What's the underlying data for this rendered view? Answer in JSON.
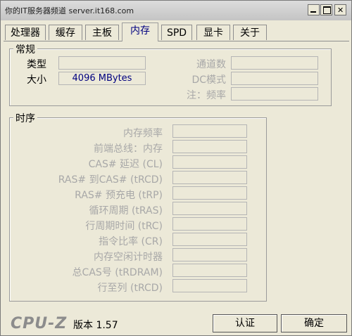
{
  "window": {
    "title": "你的IT服务器频道 server.it168.com"
  },
  "tabs": [
    {
      "label": "处理器"
    },
    {
      "label": "缓存"
    },
    {
      "label": "主板"
    },
    {
      "label": "内存"
    },
    {
      "label": "SPD"
    },
    {
      "label": "显卡"
    },
    {
      "label": "关于"
    }
  ],
  "general": {
    "title": "常规",
    "type_label": "类型",
    "type_value": "",
    "size_label": "大小",
    "size_value": "4096 MBytes",
    "channels_label": "通道数",
    "channels_value": "",
    "dc_mode_label": "DC模式",
    "dc_mode_value": "",
    "note_label": "注：频率",
    "note_value": ""
  },
  "timings": {
    "title": "时序",
    "rows": [
      {
        "label": "内存频率",
        "value": ""
      },
      {
        "label": "前端总线：内存",
        "value": ""
      },
      {
        "label": "CAS# 延迟 (CL)",
        "value": ""
      },
      {
        "label": "RAS# 到CAS# (tRCD)",
        "value": ""
      },
      {
        "label": "RAS# 预充电 (tRP)",
        "value": ""
      },
      {
        "label": "循环周期 (tRAS)",
        "value": ""
      },
      {
        "label": "行周期时间 (tRC)",
        "value": ""
      },
      {
        "label": "指令比率 (CR)",
        "value": ""
      },
      {
        "label": "内存空闲计时器",
        "value": ""
      },
      {
        "label": "总CAS号 (tRDRAM)",
        "value": ""
      },
      {
        "label": "行至列 (tRCD)",
        "value": ""
      }
    ]
  },
  "footer": {
    "logo": "CPU-Z",
    "version": "版本 1.57",
    "validate_label": "认证",
    "ok_label": "确定"
  }
}
